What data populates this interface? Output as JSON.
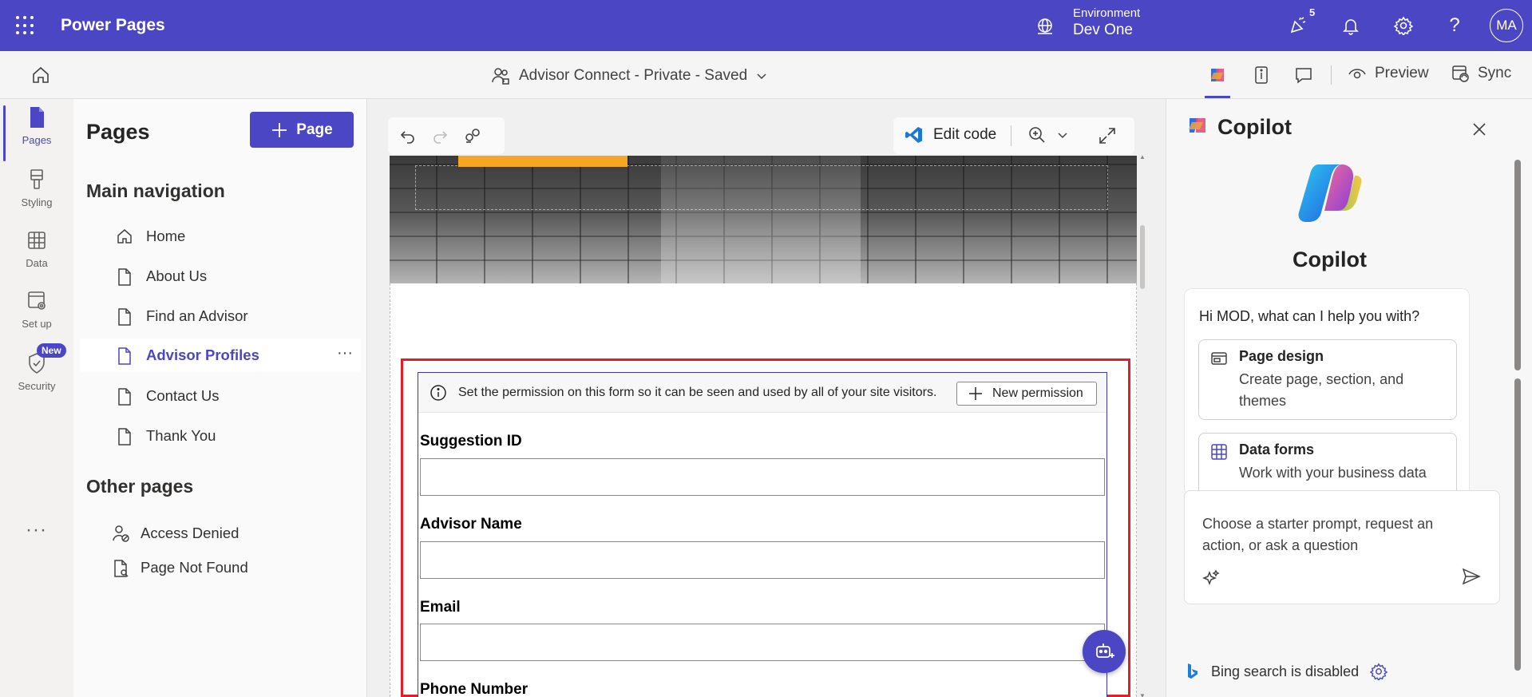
{
  "app": {
    "title": "Power Pages"
  },
  "environment": {
    "label": "Environment",
    "name": "Dev One"
  },
  "topbar": {
    "notification_count": "5",
    "avatar_initials": "MA"
  },
  "site": {
    "title": "Advisor Connect - Private - Saved"
  },
  "subbar": {
    "preview_label": "Preview",
    "sync_label": "Sync"
  },
  "rail": {
    "items": [
      {
        "label": "Pages",
        "icon": "page-icon"
      },
      {
        "label": "Styling",
        "icon": "paintbrush-icon"
      },
      {
        "label": "Data",
        "icon": "table-icon"
      },
      {
        "label": "Set up",
        "icon": "settings-window-icon"
      },
      {
        "label": "Security",
        "icon": "shield-icon"
      }
    ],
    "new_badge": "New"
  },
  "pages": {
    "title": "Pages",
    "add_label": "Page",
    "main_nav_title": "Main navigation",
    "main_nav": [
      {
        "label": "Home",
        "icon": "home-icon"
      },
      {
        "label": "About Us",
        "icon": "document-icon"
      },
      {
        "label": "Find an Advisor",
        "icon": "document-icon"
      },
      {
        "label": "Advisor Profiles",
        "icon": "document-icon",
        "active": true
      },
      {
        "label": "Contact Us",
        "icon": "document-icon"
      },
      {
        "label": "Thank You",
        "icon": "document-icon"
      }
    ],
    "other_title": "Other pages",
    "other": [
      {
        "label": "Access Denied",
        "icon": "person-lock-icon"
      },
      {
        "label": "Page Not Found",
        "icon": "document-search-icon"
      }
    ]
  },
  "canvas": {
    "edit_code_label": "Edit code",
    "permission_text": "Set the permission on this form so it can be seen and used by all of your site visitors.",
    "new_permission_label": "New permission",
    "fields": [
      {
        "label": "Suggestion ID",
        "value": ""
      },
      {
        "label": "Advisor Name",
        "value": ""
      },
      {
        "label": "Email",
        "value": ""
      },
      {
        "label": "Phone Number",
        "value": ""
      }
    ]
  },
  "copilot": {
    "header": "Copilot",
    "title": "Copilot",
    "greeting": "Hi MOD, what can I help you with?",
    "suggestions": [
      {
        "title": "Page design",
        "desc": "Create page, section, and themes"
      },
      {
        "title": "Data forms",
        "desc": "Work with your business data"
      }
    ],
    "input_placeholder": "Choose a starter prompt, request an action, or ask a question",
    "bing_status": "Bing search is disabled"
  },
  "colors": {
    "brand": "#4b47c4",
    "highlight": "#e41e26",
    "accent_orange": "#f5a623"
  }
}
